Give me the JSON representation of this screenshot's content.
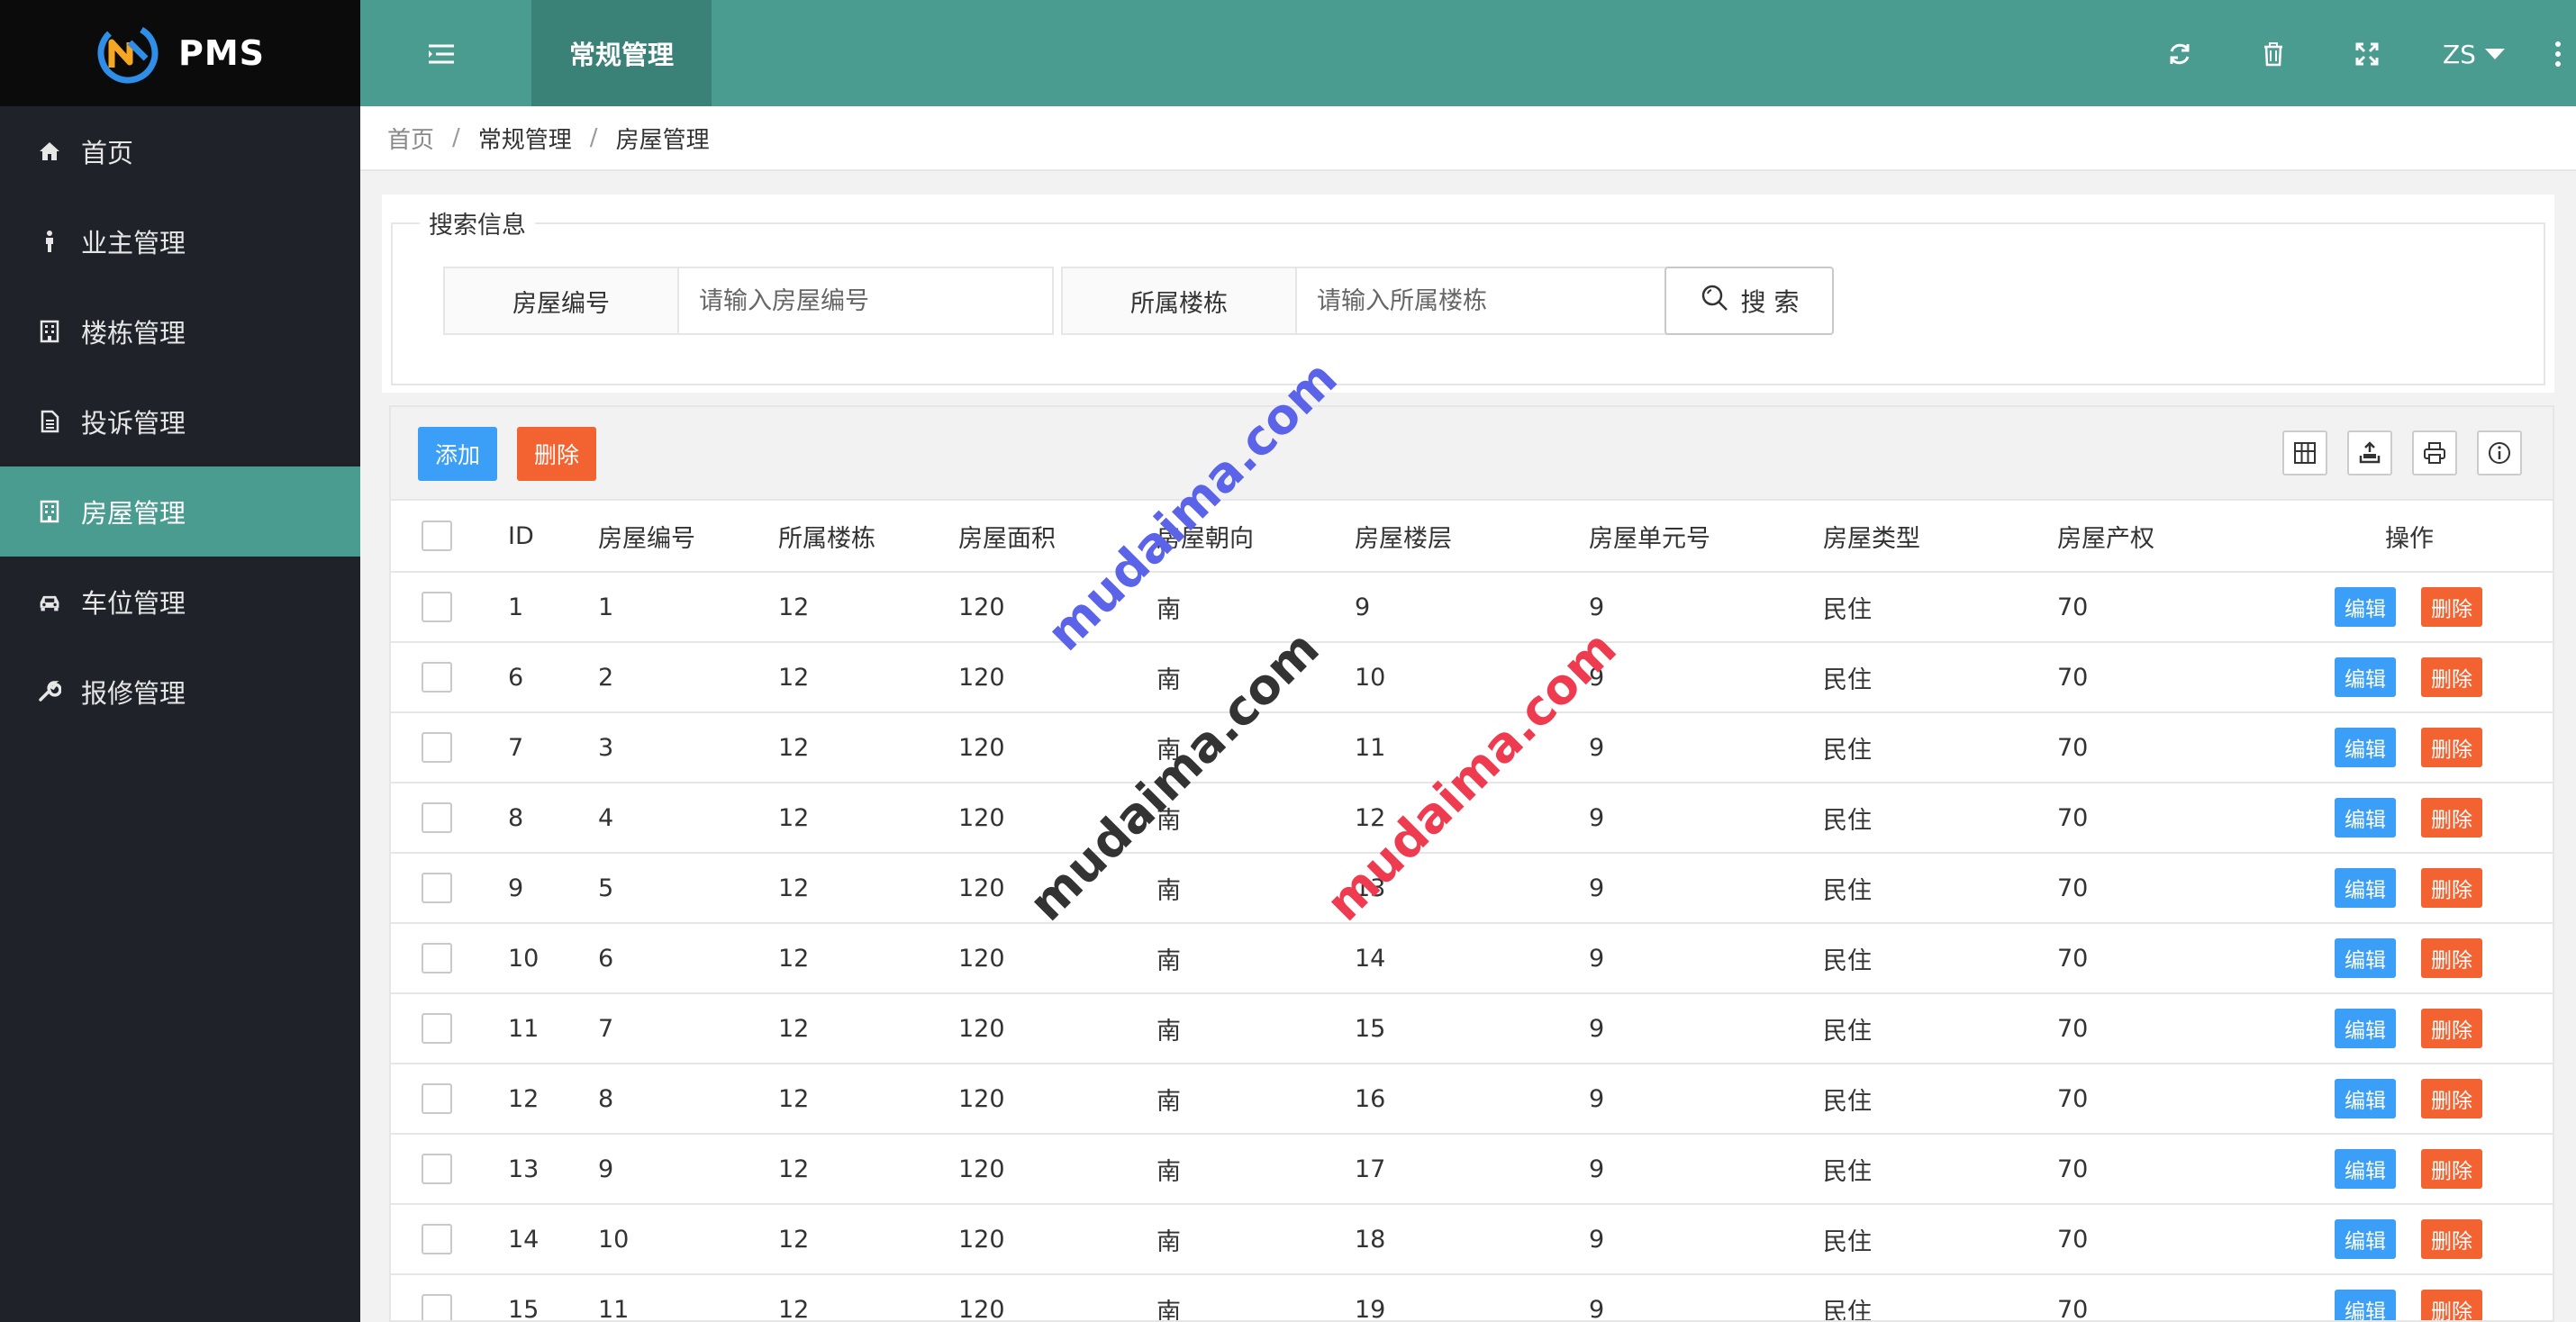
{
  "app": {
    "name": "PMS"
  },
  "sidebar": {
    "items": [
      {
        "label": "首页",
        "icon": "home-icon"
      },
      {
        "label": "业主管理",
        "icon": "person-icon"
      },
      {
        "label": "楼栋管理",
        "icon": "building-icon"
      },
      {
        "label": "投诉管理",
        "icon": "document-icon"
      },
      {
        "label": "房屋管理",
        "icon": "house-icon",
        "active": true
      },
      {
        "label": "车位管理",
        "icon": "car-icon"
      },
      {
        "label": "报修管理",
        "icon": "wrench-icon"
      }
    ]
  },
  "header": {
    "tab": "常规管理",
    "user": "ZS",
    "icons": [
      "refresh-icon",
      "trash-icon",
      "fullscreen-icon",
      "more-icon"
    ]
  },
  "breadcrumb": [
    "首页",
    "常规管理",
    "房屋管理"
  ],
  "search": {
    "legend": "搜索信息",
    "house_no_label": "房屋编号",
    "house_no_placeholder": "请输入房屋编号",
    "building_label": "所属楼栋",
    "building_placeholder": "请输入所属楼栋",
    "button_label": "搜 索"
  },
  "toolbar": {
    "add_label": "添加",
    "delete_label": "删除",
    "icons": [
      "columns-icon",
      "export-icon",
      "print-icon",
      "info-icon"
    ]
  },
  "table": {
    "columns": [
      "ID",
      "房屋编号",
      "所属楼栋",
      "房屋面积",
      "房屋朝向",
      "房屋楼层",
      "房屋单元号",
      "房屋类型",
      "房屋产权",
      "操作"
    ],
    "edit_label": "编辑",
    "delete_label": "删除",
    "rows": [
      [
        "1",
        "1",
        "12",
        "120",
        "南",
        "9",
        "9",
        "民住",
        "70"
      ],
      [
        "6",
        "2",
        "12",
        "120",
        "南",
        "10",
        "9",
        "民住",
        "70"
      ],
      [
        "7",
        "3",
        "12",
        "120",
        "南",
        "11",
        "9",
        "民住",
        "70"
      ],
      [
        "8",
        "4",
        "12",
        "120",
        "南",
        "12",
        "9",
        "民住",
        "70"
      ],
      [
        "9",
        "5",
        "12",
        "120",
        "南",
        "13",
        "9",
        "民住",
        "70"
      ],
      [
        "10",
        "6",
        "12",
        "120",
        "南",
        "14",
        "9",
        "民住",
        "70"
      ],
      [
        "11",
        "7",
        "12",
        "120",
        "南",
        "15",
        "9",
        "民住",
        "70"
      ],
      [
        "12",
        "8",
        "12",
        "120",
        "南",
        "16",
        "9",
        "民住",
        "70"
      ],
      [
        "13",
        "9",
        "12",
        "120",
        "南",
        "17",
        "9",
        "民住",
        "70"
      ],
      [
        "14",
        "10",
        "12",
        "120",
        "南",
        "18",
        "9",
        "民住",
        "70"
      ],
      [
        "15",
        "11",
        "12",
        "120",
        "南",
        "19",
        "9",
        "民住",
        "70"
      ]
    ]
  },
  "watermarks": [
    "mudaima.com",
    "mudaima.com",
    "mudaima.com"
  ],
  "colors": {
    "primary": "#4a9c90",
    "sidebar_bg": "#20222a",
    "blue": "#3b9ff7",
    "orange": "#f26331",
    "watermark_blue": "#5b63e8",
    "watermark_dark": "#333333",
    "watermark_red": "#ee3b4f"
  }
}
